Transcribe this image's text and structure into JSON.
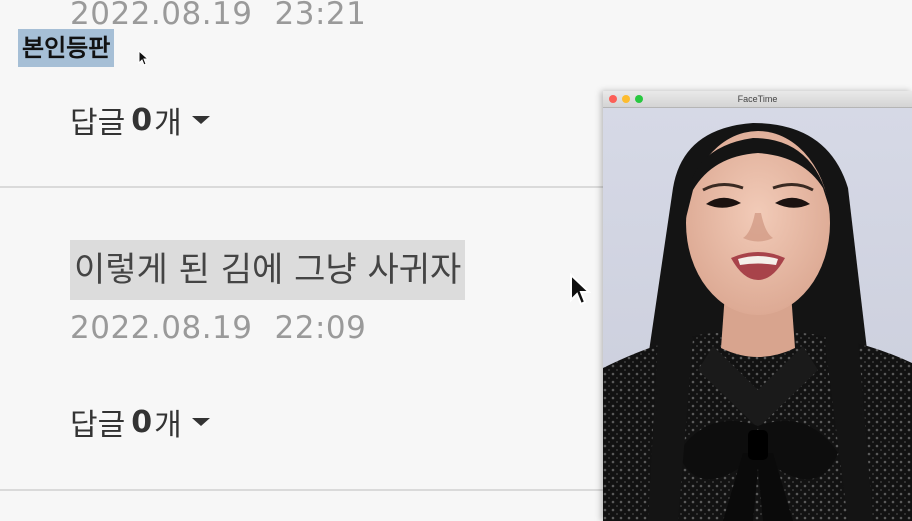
{
  "comments": [
    {
      "date": "2022.08.19",
      "time": "23:21",
      "tag": "본인등판",
      "reply_label": "답글",
      "reply_count": "0",
      "reply_unit": "개"
    },
    {
      "text": "이렇게 된 김에 그냥 사귀자",
      "date": "2022.08.19",
      "time": "22:09",
      "reply_label": "답글",
      "reply_count": "0",
      "reply_unit": "개"
    }
  ],
  "facetime": {
    "title": "FaceTime"
  },
  "colors": {
    "tag_bg": "#a6bfd6",
    "highlight_bg": "#dcdcdc",
    "timestamp": "#9a9a9a"
  },
  "icons": {
    "caret": "caret-down-icon",
    "cursor": "mouse-pointer-icon"
  }
}
